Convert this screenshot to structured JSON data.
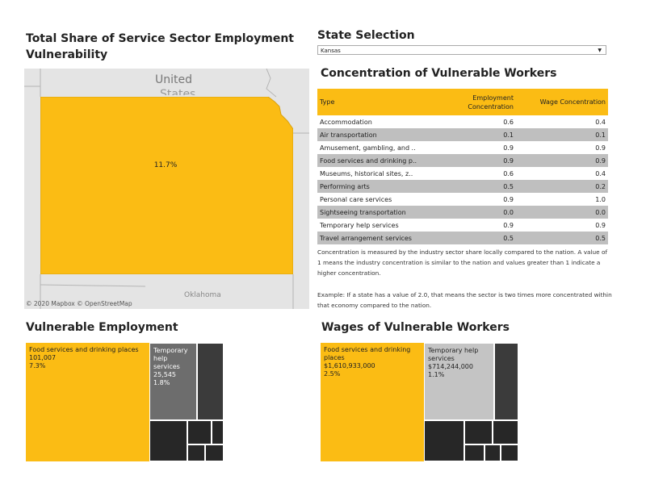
{
  "map_section": {
    "title_line1": "Total Share of Service Sector Employment",
    "title_line2": "Vulnerability",
    "country_label": "United",
    "country_label_2": "States",
    "state_value": "11.7%",
    "neighbor_label": "Oklahoma",
    "attribution": "© 2020 Mapbox  © OpenStreetMap",
    "colors": {
      "state_fill": "#fbbc14",
      "map_background": "#e4e4e4"
    }
  },
  "state_selection": {
    "title": "State Selection",
    "selected": "Kansas",
    "arrow_icon": "dropdown-arrow-icon"
  },
  "concentration": {
    "title": "Concentration of Vulnerable Workers",
    "headers": {
      "type": "Type",
      "employment_1": "Employment",
      "employment_2": "Concentration",
      "wage": "Wage Concentration"
    },
    "rows": [
      {
        "type": "Accommodation",
        "employment": "0.6",
        "wage": "0.4"
      },
      {
        "type": "Air transportation",
        "employment": "0.1",
        "wage": "0.1"
      },
      {
        "type": "Amusement, gambling, and ..",
        "employment": "0.9",
        "wage": "0.9"
      },
      {
        "type": "Food services and drinking p..",
        "employment": "0.9",
        "wage": "0.9"
      },
      {
        "type": "Museums, historical sites, z..",
        "employment": "0.6",
        "wage": "0.4"
      },
      {
        "type": "Performing arts",
        "employment": "0.5",
        "wage": "0.2"
      },
      {
        "type": "Personal care services",
        "employment": "0.9",
        "wage": "1.0"
      },
      {
        "type": "Sightseeing transportation",
        "employment": "0.0",
        "wage": "0.0"
      },
      {
        "type": "Temporary help services",
        "employment": "0.9",
        "wage": "0.9"
      },
      {
        "type": "Travel arrangement services",
        "employment": "0.5",
        "wage": "0.5"
      }
    ],
    "note1": "Concentration is measured by the industry sector share locally compared to the nation. A value of 1 means the industry concentration is similar to the nation and values greater than 1 indicate a higher concentration.",
    "note2": "Example: If a state has a value of 2.0, that means the sector is two times more concentrated within that economy compared to the nation."
  },
  "vulnerable_employment": {
    "title": "Vulnerable Employment",
    "tile1": {
      "name": "Food services and drinking places",
      "value": "101,007",
      "pct": "7.3%"
    },
    "tile2": {
      "name_1": "Temporary",
      "name_2": "help",
      "name_3": "services",
      "value": "25,545",
      "pct": "1.8%"
    }
  },
  "vulnerable_wages": {
    "title": "Wages of Vulnerable  Workers",
    "tile1": {
      "name_1": "Food services and drinking",
      "name_2": "places",
      "value": "$1,610,933,000",
      "pct": "2.5%"
    },
    "tile2": {
      "name_1": "Temporary help",
      "name_2": "services",
      "value": "$714,244,000",
      "pct": "1.1%"
    }
  }
}
